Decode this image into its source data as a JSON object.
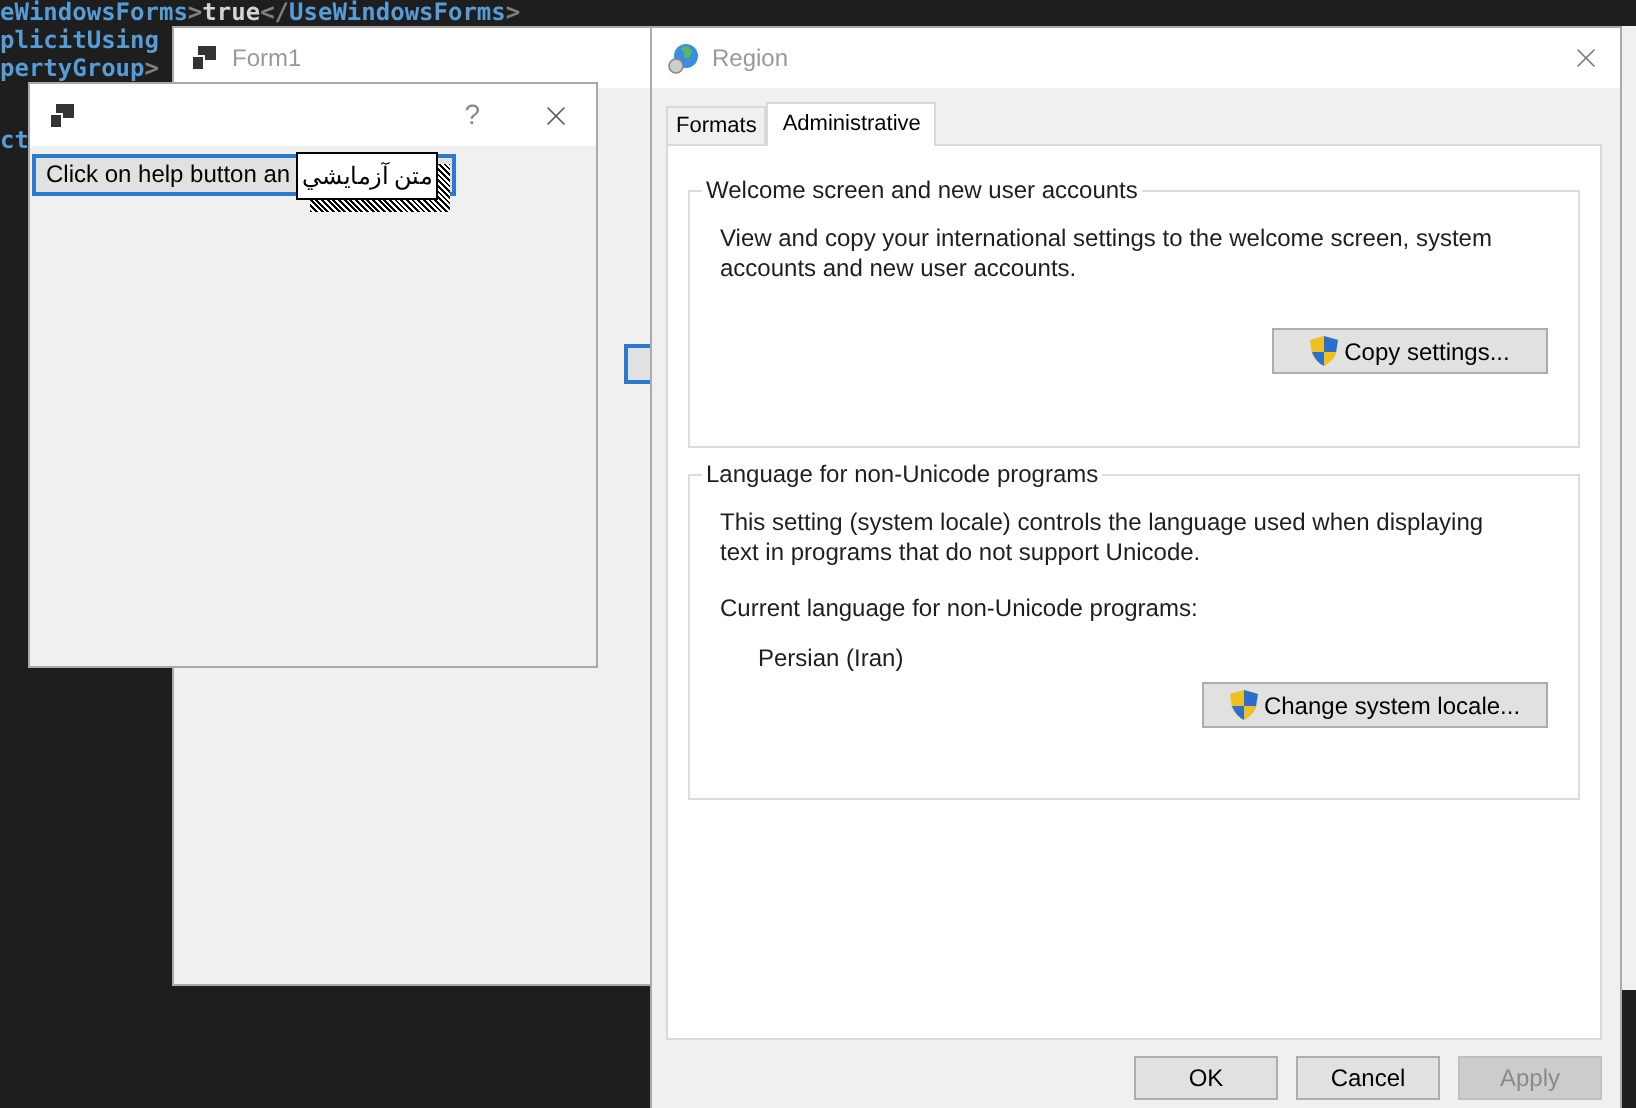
{
  "code_editor": {
    "lines": [
      {
        "segments": [
          {
            "kind": "tag",
            "text": "eWindowsForms"
          },
          {
            "kind": "punct",
            "text": ">"
          },
          {
            "kind": "value",
            "text": "true"
          },
          {
            "kind": "punct",
            "text": "</"
          },
          {
            "kind": "tag",
            "text": "UseWindowsForms"
          },
          {
            "kind": "punct",
            "text": ">"
          }
        ]
      },
      {
        "segments": [
          {
            "kind": "tag",
            "text": "plicitUsing"
          }
        ]
      },
      {
        "segments": [
          {
            "kind": "tag",
            "text": "pertyGroup"
          },
          {
            "kind": "punct",
            "text": ">"
          }
        ]
      },
      {
        "blank_before": true,
        "segments": [
          {
            "kind": "tag",
            "text": "ct"
          }
        ]
      }
    ]
  },
  "form1": {
    "title": "Form1"
  },
  "dialog": {
    "help_label": "?",
    "button_label": "Click on help button an",
    "tooltip": "متن آزمايشي"
  },
  "region": {
    "title": "Region",
    "tabs": [
      {
        "label": "Formats",
        "selected": false
      },
      {
        "label": "Administrative",
        "selected": true
      }
    ],
    "groups": [
      {
        "title": "Welcome screen and new user accounts",
        "paragraphs": [
          "View and copy your international settings to the welcome screen, system accounts and new user accounts."
        ],
        "button": "Copy settings..."
      },
      {
        "title": "Language for non-Unicode programs",
        "paragraphs": [
          "This setting (system locale) controls the language used when displaying text in programs that do not support Unicode.",
          "Current language for non-Unicode programs:"
        ],
        "value": "Persian (Iran)",
        "button": "Change system locale..."
      }
    ],
    "buttons": [
      {
        "label": "OK",
        "disabled": false
      },
      {
        "label": "Cancel",
        "disabled": false
      },
      {
        "label": "Apply",
        "disabled": true
      }
    ]
  }
}
